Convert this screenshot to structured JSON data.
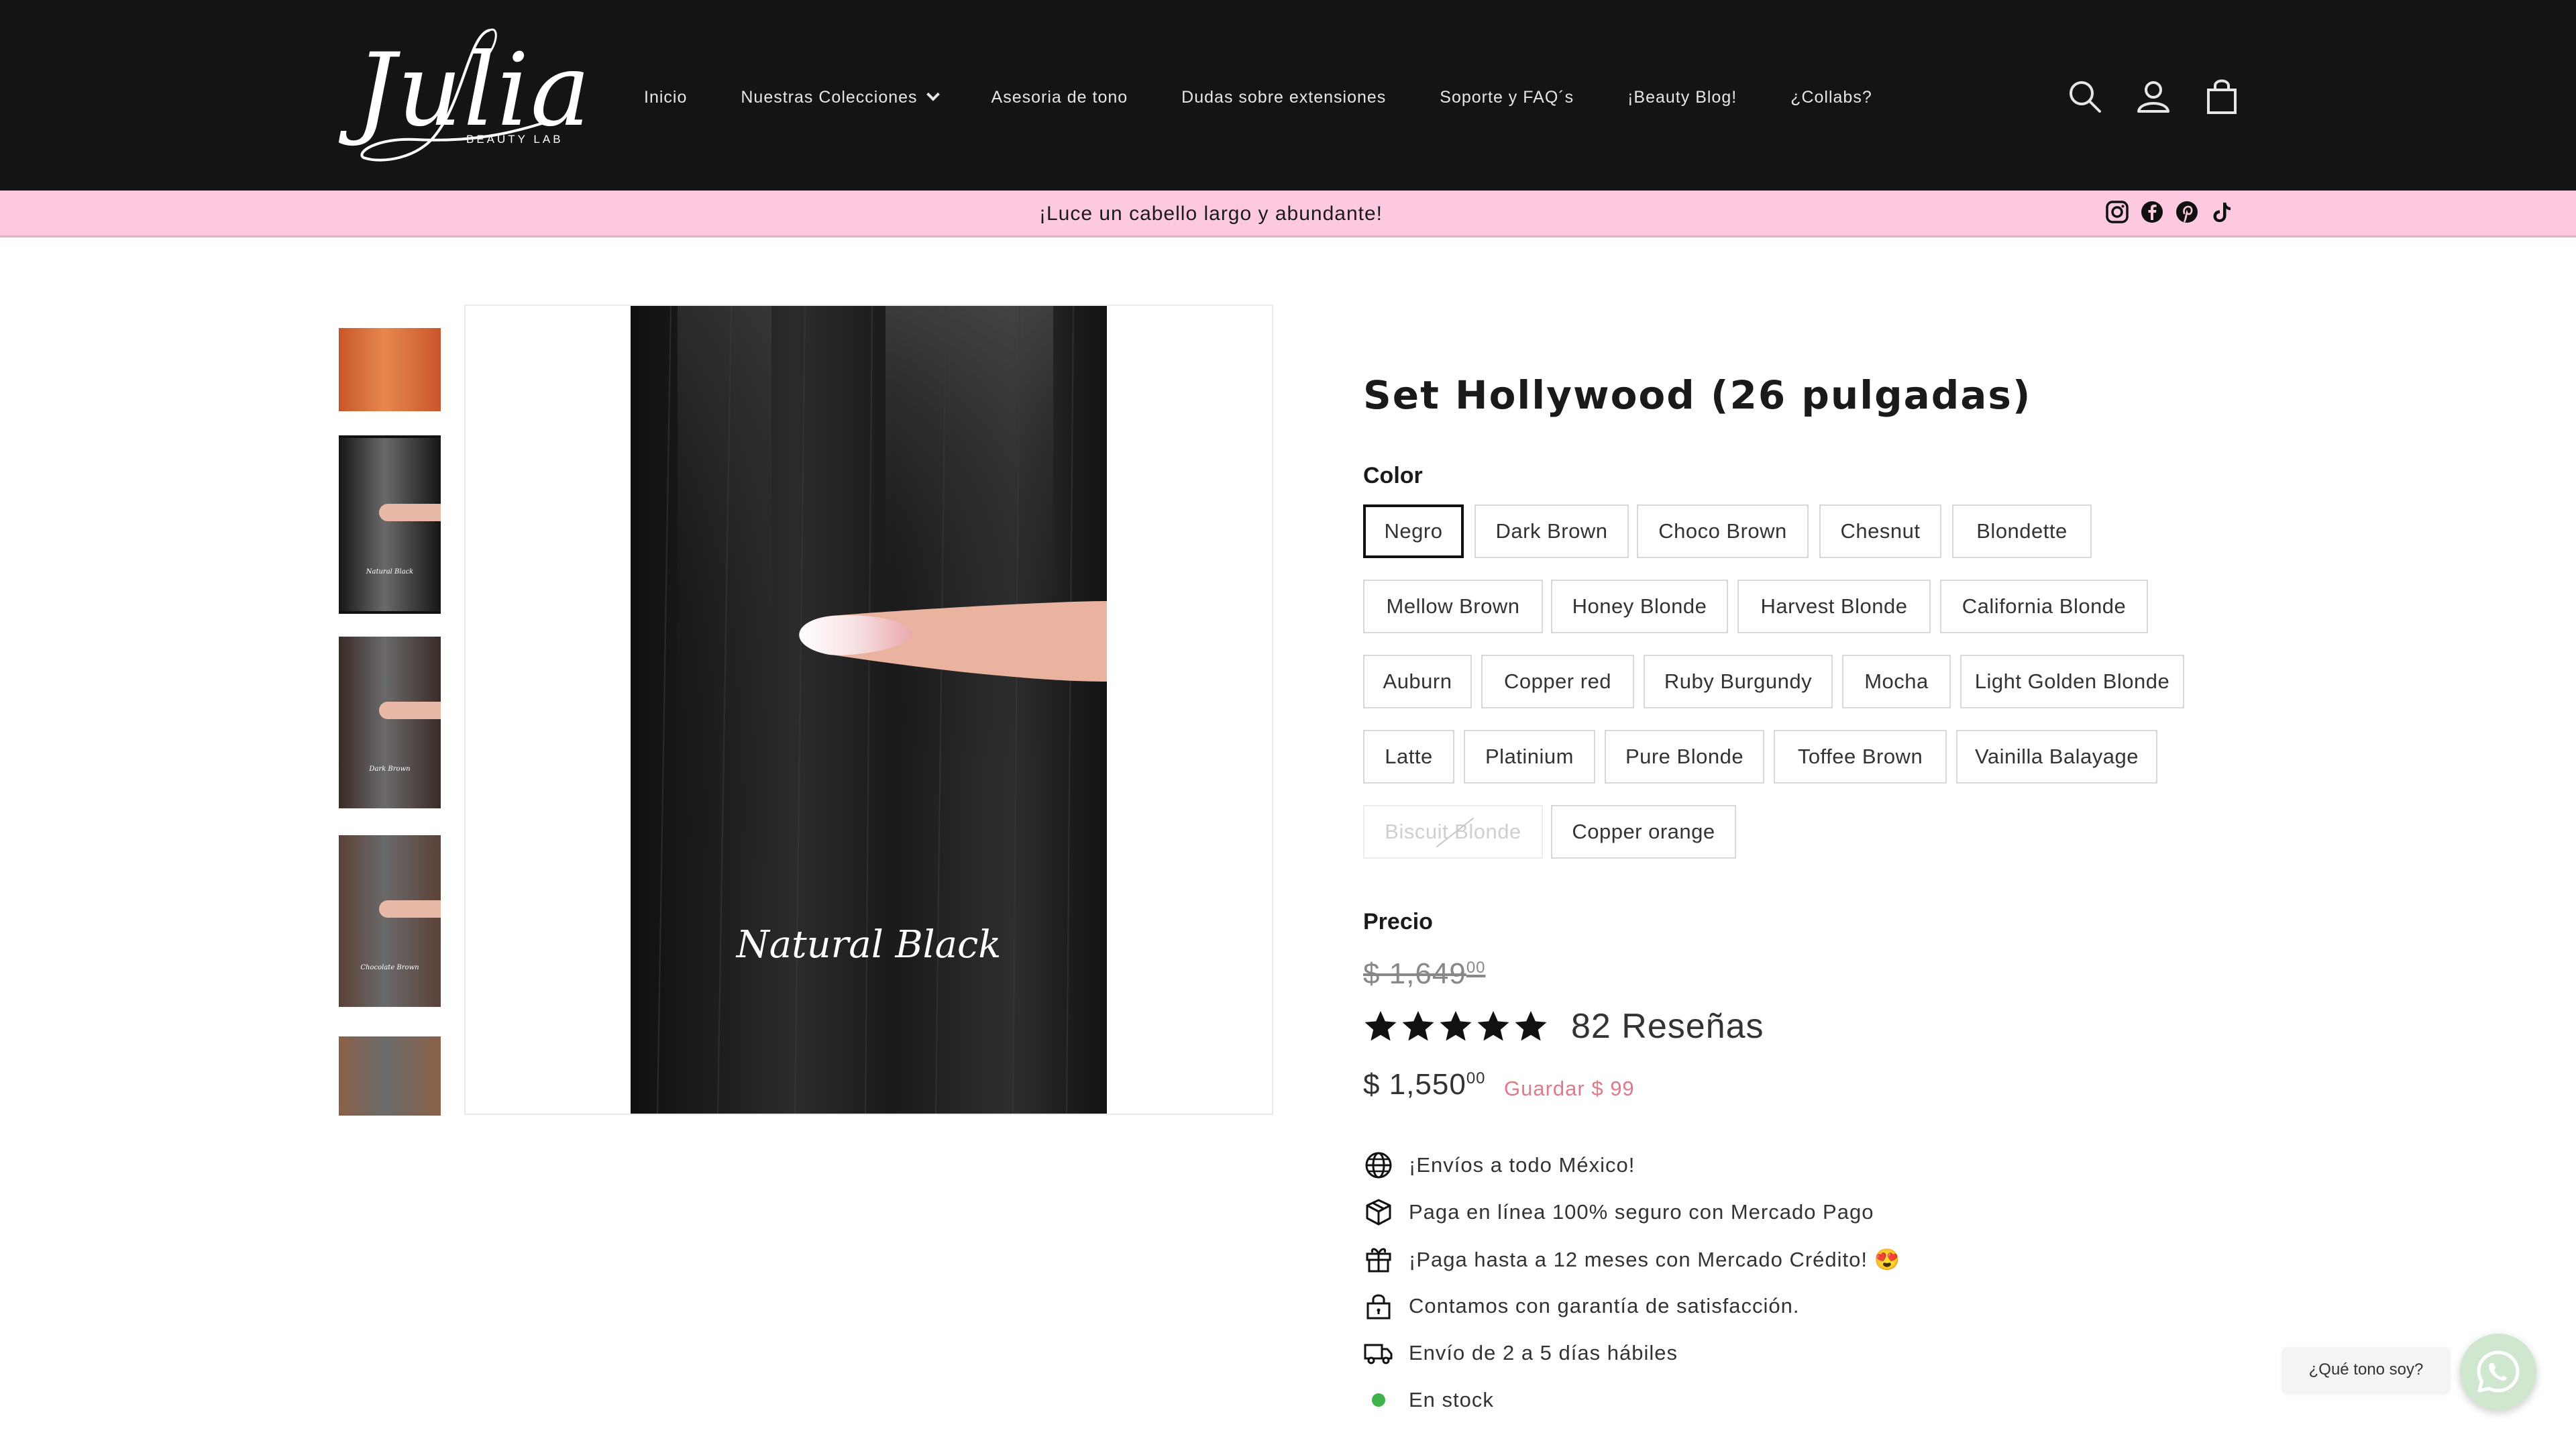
{
  "brand": {
    "logo_script": "Julia",
    "logo_sub": "BEAUTY LAB"
  },
  "nav": [
    {
      "label": "Inicio"
    },
    {
      "label": "Nuestras Colecciones",
      "has_dropdown": true
    },
    {
      "label": "Asesoria de tono"
    },
    {
      "label": "Dudas sobre extensiones"
    },
    {
      "label": "Soporte y FAQ´s"
    },
    {
      "label": "¡Beauty Blog!"
    },
    {
      "label": "¿Collabs?"
    }
  ],
  "header_icons": [
    "search-icon",
    "account-icon",
    "cart-icon"
  ],
  "announcement": {
    "text": "¡Luce un cabello largo y abundante!"
  },
  "social": [
    "instagram-icon",
    "facebook-icon",
    "pinterest-icon",
    "tiktok-icon"
  ],
  "gallery": {
    "thumbnails": [
      {
        "caption": "",
        "tone": "#c8552a"
      },
      {
        "caption": "Natural Black",
        "tone": "#161616",
        "selected": true
      },
      {
        "caption": "Dark Brown",
        "tone": "#3a2b27"
      },
      {
        "caption": "Chocolate Brown",
        "tone": "#5b4137"
      },
      {
        "caption": "",
        "tone": "#8b6048"
      }
    ],
    "main_caption": "Natural Black"
  },
  "product": {
    "title": "Set Hollywood (26 pulgadas)",
    "color_label": "Color",
    "colors": [
      {
        "label": "Negro",
        "selected": true
      },
      {
        "label": "Dark Brown"
      },
      {
        "label": "Choco Brown"
      },
      {
        "label": "Chesnut"
      },
      {
        "label": "Blondette"
      },
      {
        "label": "Mellow Brown"
      },
      {
        "label": "Honey Blonde"
      },
      {
        "label": "Harvest Blonde"
      },
      {
        "label": "California Blonde"
      },
      {
        "label": "Auburn"
      },
      {
        "label": "Copper red"
      },
      {
        "label": "Ruby Burgundy"
      },
      {
        "label": "Mocha"
      },
      {
        "label": "Light Golden Blonde"
      },
      {
        "label": "Latte"
      },
      {
        "label": "Platinium"
      },
      {
        "label": "Pure Blonde"
      },
      {
        "label": "Toffee Brown"
      },
      {
        "label": "Vainilla Balayage"
      },
      {
        "label": "Biscuit Blonde",
        "disabled": true
      },
      {
        "label": "Copper orange"
      }
    ],
    "price_label": "Precio",
    "price_old_main": "$ 1,649",
    "price_old_cents": "00",
    "rating": 5,
    "reviews": "82 Reseñas",
    "price_new_main": "$ 1,550",
    "price_new_cents": "00",
    "save": "Guardar $ 99"
  },
  "features": [
    {
      "icon": "globe-icon",
      "text": "¡Envíos a todo México!"
    },
    {
      "icon": "package-icon",
      "text": "Paga en línea 100% seguro con Mercado Pago"
    },
    {
      "icon": "gift-icon",
      "text": "¡Paga hasta a 12 meses con Mercado Crédito! 😍"
    },
    {
      "icon": "lock-icon",
      "text": "Contamos con garantía de satisfacción."
    },
    {
      "icon": "truck-icon",
      "text": "Envío de 2 a 5 días hábiles"
    },
    {
      "icon": "stock-dot",
      "text": "En stock"
    }
  ],
  "whatsapp": {
    "bubble_text": "¿Qué tono soy?"
  },
  "colors": {
    "header_bg": "#141414",
    "announce_bg": "#fdc9e1",
    "save": "#e07a8a",
    "stock": "#3fb24b"
  }
}
